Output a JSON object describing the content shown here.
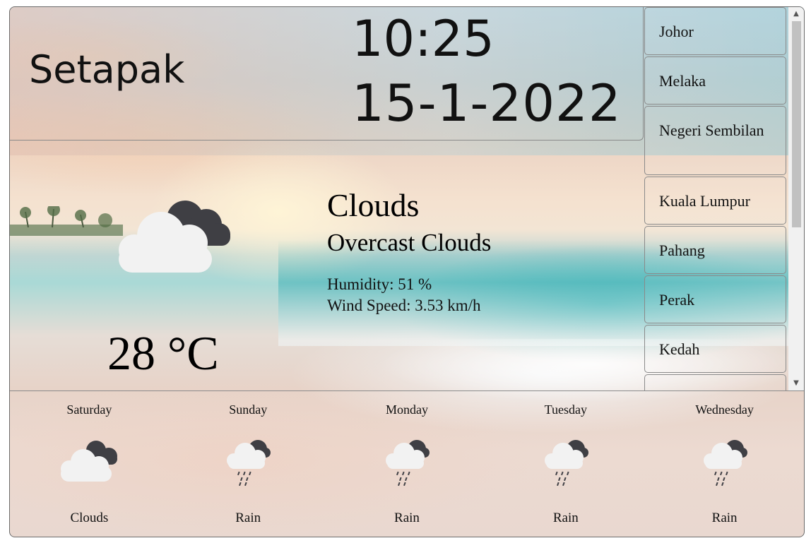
{
  "location": {
    "city": "Setapak"
  },
  "clock": {
    "time": "10:25",
    "date": "15-1-2022"
  },
  "current": {
    "condition": "Clouds",
    "description": "Overcast Clouds",
    "humidity": "Humidity: 51 %",
    "wind": "Wind Speed: 3.53 km/h",
    "temperature": "28 °C",
    "icon": "cloudy-icon"
  },
  "states": [
    "Johor",
    "Melaka",
    "Negeri Sembilan",
    "Kuala Lumpur",
    "Pahang",
    "Perak",
    "Kedah"
  ],
  "forecast": [
    {
      "day": "Saturday",
      "condition": "Clouds",
      "icon": "cloudy-icon"
    },
    {
      "day": "Sunday",
      "condition": "Rain",
      "icon": "rain-icon"
    },
    {
      "day": "Monday",
      "condition": "Rain",
      "icon": "rain-icon"
    },
    {
      "day": "Tuesday",
      "condition": "Rain",
      "icon": "rain-icon"
    },
    {
      "day": "Wednesday",
      "condition": "Rain",
      "icon": "rain-icon"
    }
  ],
  "colors": {
    "text": "#111111",
    "border": "#8a8a8a",
    "cloud_light": "#f2f2f2",
    "cloud_dark": "#3f3f44"
  }
}
